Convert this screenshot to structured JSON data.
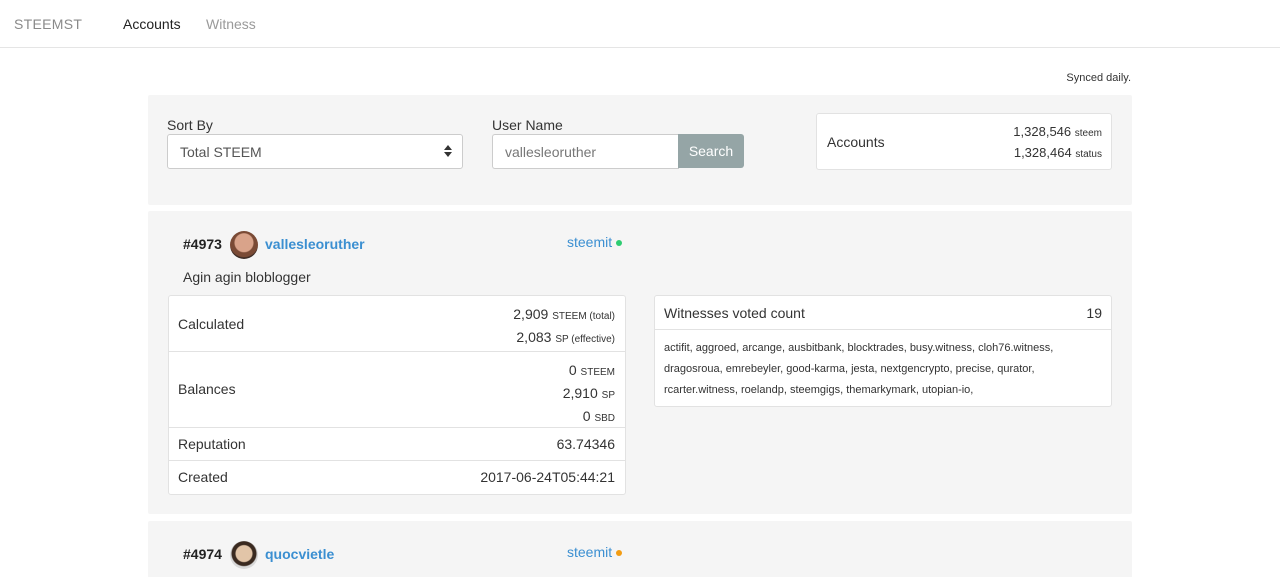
{
  "nav": {
    "brand": "STEEMST",
    "links": [
      "Accounts",
      "Witness"
    ]
  },
  "synced_text": "Synced daily.",
  "filters": {
    "sort_label": "Sort By",
    "sort_value": "Total STEEM",
    "user_label": "User Name",
    "user_value": "vallesleoruther",
    "search_button": "Search"
  },
  "accounts_summary": {
    "title": "Accounts",
    "steem_count": "1,328,546",
    "steem_unit": "steem",
    "status_count": "1,328,464",
    "status_unit": "status"
  },
  "accounts": [
    {
      "rank": "#4973",
      "username": "vallesleoruther",
      "platform": "steemit",
      "status_color": "#2ecc71",
      "bio": "Agin agin bloblogger",
      "calculated_label": "Calculated",
      "total_steem": "2,909",
      "total_steem_unit": "STEEM (total)",
      "effective_sp": "2,083",
      "effective_sp_unit": "SP (effective)",
      "balances_label": "Balances",
      "balance_steem": "0",
      "balance_steem_unit": "STEEM",
      "balance_sp": "2,910",
      "balance_sp_unit": "SP",
      "balance_sbd": "0",
      "balance_sbd_unit": "SBD",
      "reputation_label": "Reputation",
      "reputation": "63.74346",
      "created_label": "Created",
      "created": "2017-06-24T05:44:21",
      "witness_title": "Witnesses voted count",
      "witness_count": "19",
      "witnesses": "actifit, aggroed, arcange, ausbitbank, blocktrades, busy.witness, cloh76.witness, dragosroua, emrebeyler, good-karma, jesta, nextgencrypto, precise, qurator, rcarter.witness, roelandp, steemgigs, themarkymark, utopian-io,"
    },
    {
      "rank": "#4974",
      "username": "quocvietle",
      "platform": "steemit",
      "status_color": "#f39c12"
    }
  ]
}
